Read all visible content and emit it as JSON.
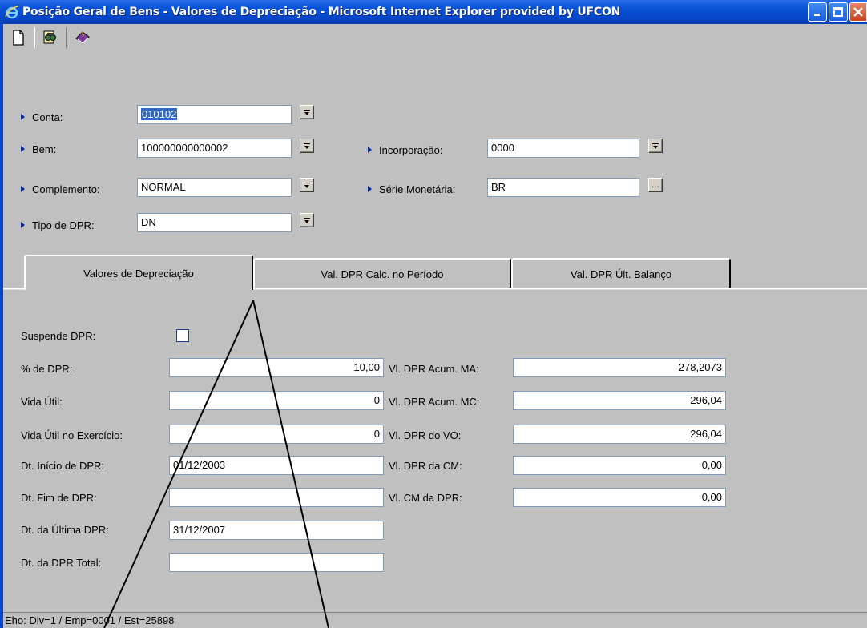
{
  "window": {
    "title": "Posição Geral de Bens - Valores de Depreciação - Microsoft Internet Explorer provided by UFCON"
  },
  "toolbar": {
    "buttons": [
      "new-document-icon",
      "search-binoculars-icon",
      "book-icon"
    ]
  },
  "header_form": {
    "conta": {
      "label": "Conta:",
      "value": "010102"
    },
    "bem": {
      "label": "Bem:",
      "value": "100000000000002"
    },
    "complemento": {
      "label": "Complemento:",
      "value": "NORMAL"
    },
    "tipo_dpr": {
      "label": "Tipo de DPR:",
      "value": "DN"
    },
    "incorporacao": {
      "label": "Incorporação:",
      "value": "0000"
    },
    "serie_monetaria": {
      "label": "Série Monetária:",
      "value": "BR",
      "button": "..."
    }
  },
  "tabs": [
    {
      "label": "Valores de Depreciação",
      "active": true
    },
    {
      "label": "Val. DPR Calc. no Período",
      "active": false
    },
    {
      "label": "Val. DPR Últ. Balanço",
      "active": false
    }
  ],
  "details": {
    "suspende_dpr": {
      "label": "Suspende DPR:",
      "checked": false
    },
    "perc_dpr": {
      "label": "% de DPR:",
      "value": "10,00"
    },
    "vida_util": {
      "label": "Vida Útil:",
      "value": "0"
    },
    "vida_util_exercicio": {
      "label": "Vida Útil no Exercício:",
      "value": "0"
    },
    "dt_inicio_dpr": {
      "label": "Dt. Início de DPR:",
      "value": "01/12/2003"
    },
    "dt_fim_dpr": {
      "label": "Dt. Fim de DPR:",
      "value": ""
    },
    "dt_ultima_dpr": {
      "label": "Dt. da Última DPR:",
      "value": "31/12/2007"
    },
    "dt_dpr_total": {
      "label": "Dt. da DPR Total:",
      "value": ""
    },
    "vl_dpr_acum_ma": {
      "label": "Vl. DPR Acum. MA:",
      "value": "278,2073"
    },
    "vl_dpr_acum_mc": {
      "label": "Vl. DPR Acum. MC:",
      "value": "296,04"
    },
    "vl_dpr_vo": {
      "label": "Vl. DPR do VO:",
      "value": "296,04"
    },
    "vl_dpr_cm": {
      "label": "Vl. DPR da CM:",
      "value": "0,00"
    },
    "vl_cm_dpr": {
      "label": "Vl. CM da DPR:",
      "value": "0,00"
    }
  },
  "status": {
    "text": "Eho: Div=1 / Emp=0001 / Est=25898"
  },
  "colors": {
    "window_bg": "#c0c0c0",
    "titlebar": "#0a55d8",
    "selection": "#316ac5"
  }
}
